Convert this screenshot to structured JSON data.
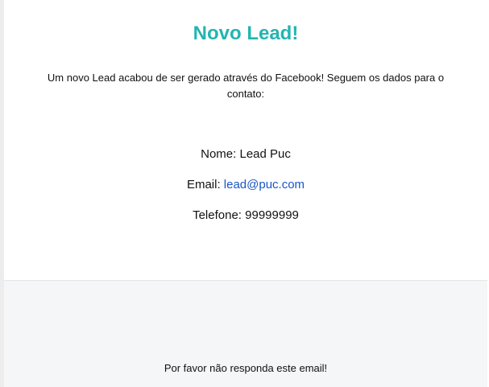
{
  "email": {
    "title": "Novo Lead!",
    "intro": "Um novo Lead acabou de ser gerado através do Facebook! Seguem os dados para o contato:",
    "fields": {
      "name_label": "Nome: ",
      "name_value": "Lead Puc",
      "email_label": "Email: ",
      "email_value": "lead@puc.com",
      "phone_label": "Telefone: ",
      "phone_value": "99999999"
    },
    "footer": "Por favor não responda este email!"
  },
  "colors": {
    "title": "#23b5b0",
    "link": "#1a55c4",
    "footer_bg": "#f4f6f7",
    "page_bg": "#ededed"
  }
}
